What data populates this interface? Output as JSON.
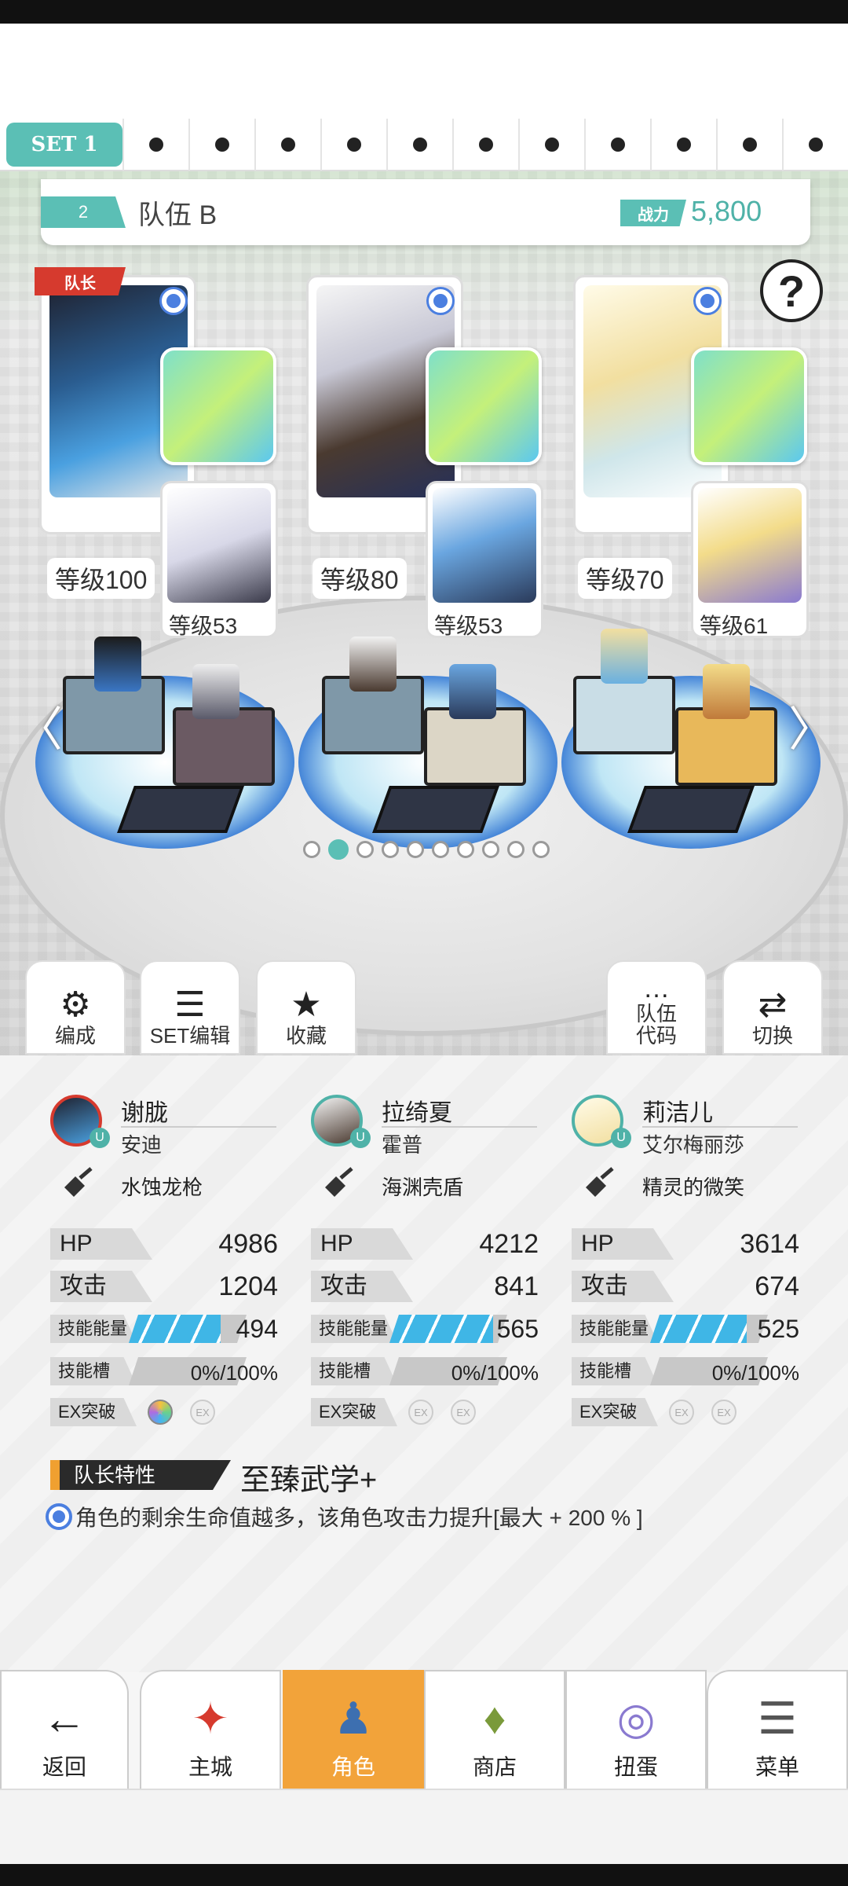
{
  "sets": {
    "active": "SET 1",
    "dot_count": 11
  },
  "team": {
    "number": "2",
    "name": "队伍 B",
    "power_label": "战力",
    "power_value": "5,800"
  },
  "help": "?",
  "captain_label": "队长",
  "members": [
    {
      "level": "等级100",
      "sub_level": "等级53"
    },
    {
      "level": "等级80",
      "sub_level": "等级53"
    },
    {
      "level": "等级70",
      "sub_level": "等级61"
    }
  ],
  "actions": {
    "formation": "编成",
    "set_edit": "SET编辑",
    "favorite": "收藏",
    "team_code_1": "队伍",
    "team_code_2": "代码",
    "switch": "切换"
  },
  "stats": [
    {
      "name": "谢胧",
      "partner": "安迪",
      "weapon": "水蚀龙枪",
      "hp_label": "HP",
      "hp": "4986",
      "atk_label": "攻击",
      "atk": "1204",
      "energy_label": "技能能量",
      "energy": "494",
      "energy_fill": 0.78,
      "slot_label": "技能槽",
      "slot": "0%/100%",
      "ex_label": "EX突破",
      "ex_text": "EX",
      "ex_active": 1
    },
    {
      "name": "拉绮夏",
      "partner": "霍普",
      "weapon": "海渊壳盾",
      "hp_label": "HP",
      "hp": "4212",
      "atk_label": "攻击",
      "atk": "841",
      "energy_label": "技能能量",
      "energy": "565",
      "energy_fill": 0.88,
      "slot_label": "技能槽",
      "slot": "0%/100%",
      "ex_label": "EX突破",
      "ex_text": "EX",
      "ex_active": 0
    },
    {
      "name": "莉洁儿",
      "partner": "艾尔梅丽莎",
      "weapon": "精灵的微笑",
      "hp_label": "HP",
      "hp": "3614",
      "atk_label": "攻击",
      "atk": "674",
      "energy_label": "技能能量",
      "energy": "525",
      "energy_fill": 0.82,
      "slot_label": "技能槽",
      "slot": "0%/100%",
      "ex_label": "EX突破",
      "ex_text": "EX",
      "ex_active": 0
    }
  ],
  "leader": {
    "label": "队长特性",
    "title": "至臻武学+",
    "desc": "角色的剩余生命值越多，该角色攻击力提升[最大 + 200 % ]"
  },
  "nav": {
    "back": "返回",
    "main_city": "主城",
    "character": "角色",
    "shop": "商店",
    "gacha": "扭蛋",
    "menu": "菜单"
  },
  "colors": {
    "teal": "#5bbfb5",
    "orange": "#f2a33a",
    "blue": "#4b7fe0",
    "red": "#d63a2e"
  },
  "pager": {
    "count": 10,
    "active": 1
  }
}
